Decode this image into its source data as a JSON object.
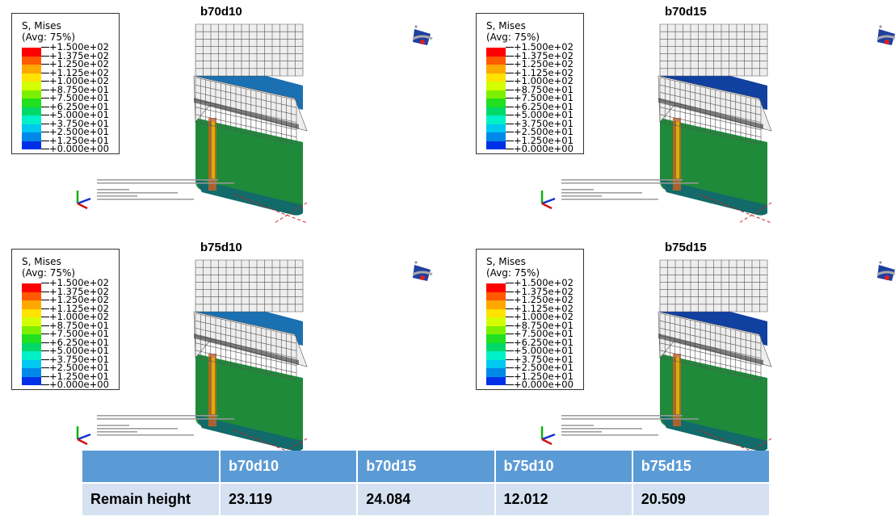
{
  "legend": {
    "title": "S, Mises",
    "subtitle": "(Avg: 75%)",
    "values": [
      "+1.500e+02",
      "+1.375e+02",
      "+1.250e+02",
      "+1.125e+02",
      "+1.000e+02",
      "+8.750e+01",
      "+7.500e+01",
      "+6.250e+01",
      "+5.000e+01",
      "+3.750e+01",
      "+2.500e+01",
      "+1.250e+01",
      "+0.000e+00"
    ],
    "colors": [
      "#ff0000",
      "#ff5a00",
      "#ffa800",
      "#ffe200",
      "#d4ff00",
      "#7cf000",
      "#20e020",
      "#00d86a",
      "#00f0c8",
      "#00c8f0",
      "#0088e8",
      "#0030e8"
    ]
  },
  "panels": [
    {
      "title": "b70d10"
    },
    {
      "title": "b70d15"
    },
    {
      "title": "b75d10"
    },
    {
      "title": "b75d15"
    }
  ],
  "table": {
    "headers": [
      "",
      "b70d10",
      "b70d15",
      "b75d10",
      "b75d15"
    ],
    "row_label": "Remain height",
    "values": [
      "23.119",
      "24.084",
      "12.012",
      "20.509"
    ],
    "header_color": "#5b9bd5",
    "row_color": "#d5e1f1"
  }
}
